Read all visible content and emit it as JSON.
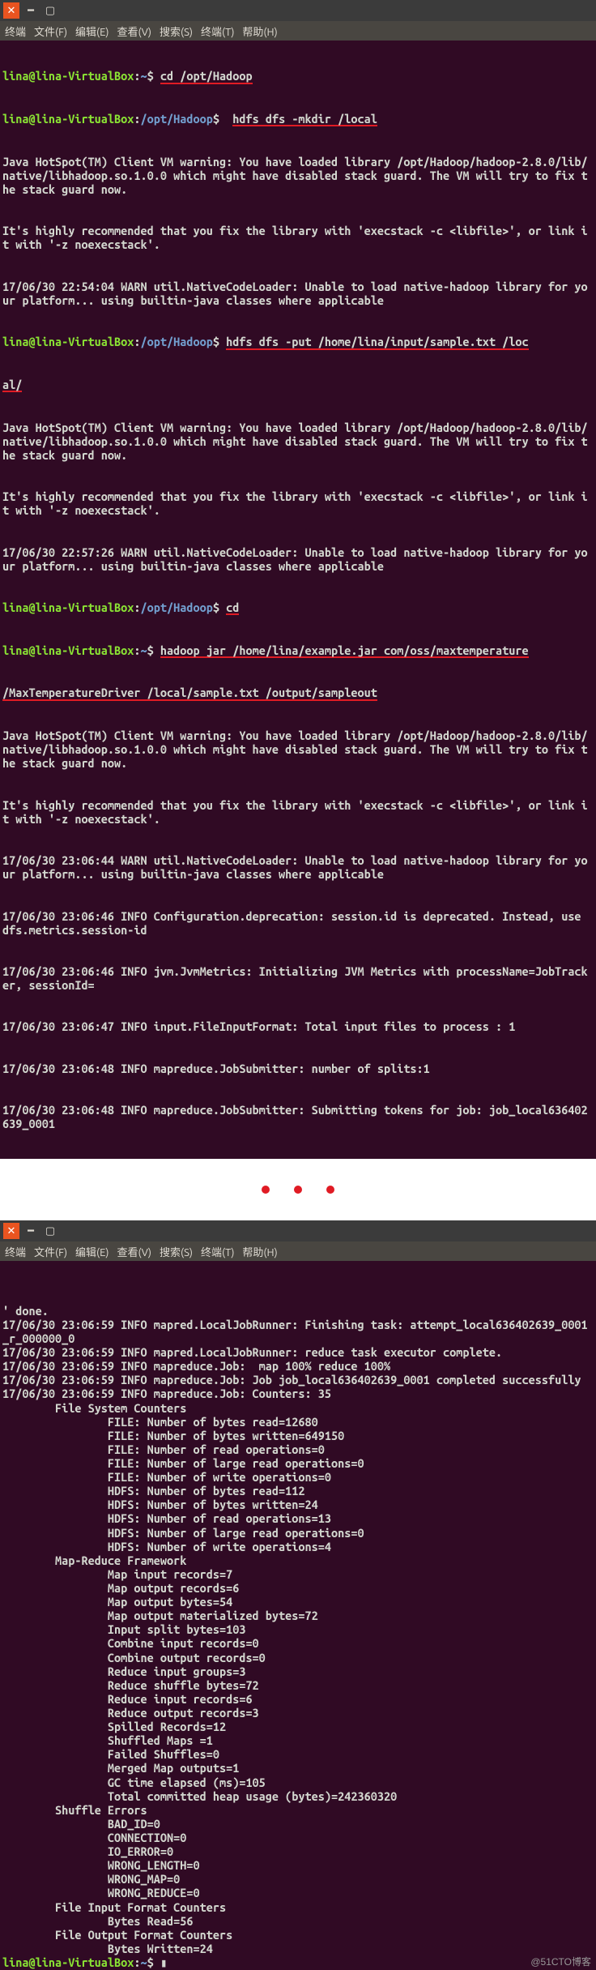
{
  "menubar": {
    "terminal": "终端",
    "file": "文件(F)",
    "edit": "编辑(E)",
    "view": "查看(V)",
    "search": "搜索(S)",
    "terminal_menu": "终端(T)",
    "help": "帮助(H)"
  },
  "prompt": {
    "user_host": "lina@lina-VirtualBox",
    "home": "~",
    "hadoop_path": "/opt/Hadoop",
    "sym": "$"
  },
  "commands": {
    "cd_hadoop": "cd /opt/Hadoop",
    "mkdir": "hdfs dfs -mkdir /local",
    "put": "hdfs dfs -put /home/lina/input/sample.txt /loc",
    "put_cont": "al/",
    "cd": "cd",
    "run_jar": "hadoop jar /home/lina/example.jar com/oss/maxtemperature",
    "run_jar_cont": "/MaxTemperatureDriver /local/sample.txt /output/sampleout"
  },
  "output1": [
    "Java HotSpot(TM) Client VM warning: You have loaded library /opt/Hadoop/hadoop-2.8.0/lib/native/libhadoop.so.1.0.0 which might have disabled stack guard. The VM will try to fix the stack guard now.",
    "It's highly recommended that you fix the library with 'execstack -c <libfile>', or link it with '-z noexecstack'.",
    "17/06/30 22:54:04 WARN util.NativeCodeLoader: Unable to load native-hadoop library for your platform... using builtin-java classes where applicable"
  ],
  "output2": [
    "Java HotSpot(TM) Client VM warning: You have loaded library /opt/Hadoop/hadoop-2.8.0/lib/native/libhadoop.so.1.0.0 which might have disabled stack guard. The VM will try to fix the stack guard now.",
    "It's highly recommended that you fix the library with 'execstack -c <libfile>', or link it with '-z noexecstack'.",
    "17/06/30 22:57:26 WARN util.NativeCodeLoader: Unable to load native-hadoop library for your platform... using builtin-java classes where applicable"
  ],
  "output3": [
    "Java HotSpot(TM) Client VM warning: You have loaded library /opt/Hadoop/hadoop-2.8.0/lib/native/libhadoop.so.1.0.0 which might have disabled stack guard. The VM will try to fix the stack guard now.",
    "It's highly recommended that you fix the library with 'execstack -c <libfile>', or link it with '-z noexecstack'.",
    "17/06/30 23:06:44 WARN util.NativeCodeLoader: Unable to load native-hadoop library for your platform... using builtin-java classes where applicable",
    "17/06/30 23:06:46 INFO Configuration.deprecation: session.id is deprecated. Instead, use dfs.metrics.session-id",
    "17/06/30 23:06:46 INFO jvm.JvmMetrics: Initializing JVM Metrics with processName=JobTracker, sessionId=",
    "17/06/30 23:06:47 INFO input.FileInputFormat: Total input files to process : 1",
    "17/06/30 23:06:48 INFO mapreduce.JobSubmitter: number of splits:1",
    "17/06/30 23:06:48 INFO mapreduce.JobSubmitter: Submitting tokens for job: job_local636402639_0001"
  ],
  "output4": [
    "' done.",
    "17/06/30 23:06:59 INFO mapred.LocalJobRunner: Finishing task: attempt_local636402639_0001_r_000000_0",
    "17/06/30 23:06:59 INFO mapred.LocalJobRunner: reduce task executor complete.",
    "17/06/30 23:06:59 INFO mapreduce.Job:  map 100% reduce 100%",
    "17/06/30 23:06:59 INFO mapreduce.Job: Job job_local636402639_0001 completed successfully",
    "17/06/30 23:06:59 INFO mapreduce.Job: Counters: 35",
    "        File System Counters",
    "                FILE: Number of bytes read=12680",
    "                FILE: Number of bytes written=649150",
    "                FILE: Number of read operations=0",
    "                FILE: Number of large read operations=0",
    "                FILE: Number of write operations=0",
    "                HDFS: Number of bytes read=112",
    "                HDFS: Number of bytes written=24",
    "                HDFS: Number of read operations=13",
    "                HDFS: Number of large read operations=0",
    "                HDFS: Number of write operations=4",
    "        Map-Reduce Framework",
    "                Map input records=7",
    "                Map output records=6",
    "                Map output bytes=54",
    "                Map output materialized bytes=72",
    "                Input split bytes=103",
    "                Combine input records=0",
    "                Combine output records=0",
    "                Reduce input groups=3",
    "                Reduce shuffle bytes=72",
    "                Reduce input records=6",
    "                Reduce output records=3",
    "                Spilled Records=12",
    "                Shuffled Maps =1",
    "                Failed Shuffles=0",
    "                Merged Map outputs=1",
    "                GC time elapsed (ms)=105",
    "                Total committed heap usage (bytes)=242360320",
    "        Shuffle Errors",
    "                BAD_ID=0",
    "                CONNECTION=0",
    "                IO_ERROR=0",
    "                WRONG_LENGTH=0",
    "                WRONG_MAP=0",
    "                WRONG_REDUCE=0",
    "        File Input Format Counters ",
    "                Bytes Read=56",
    "        File Output Format Counters ",
    "                Bytes Written=24"
  ],
  "watermark": "@51CTO博客"
}
